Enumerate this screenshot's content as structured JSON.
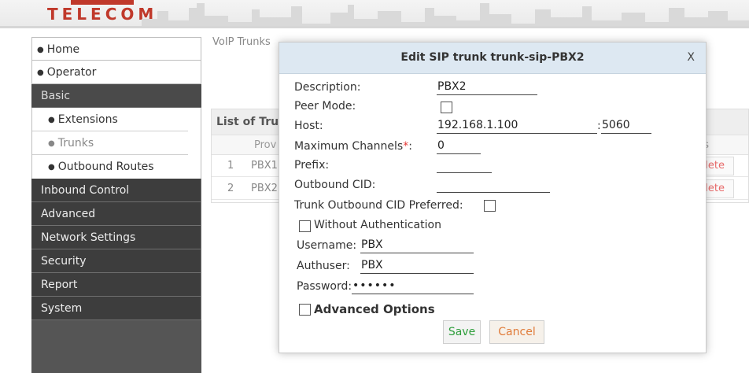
{
  "header": {
    "logo_text": "TELECOM"
  },
  "sidebar": {
    "top_items": [
      {
        "label": "Home"
      },
      {
        "label": "Operator"
      }
    ],
    "basic_label": "Basic",
    "basic_items": [
      {
        "label": "Extensions"
      },
      {
        "label": "Trunks"
      },
      {
        "label": "Outbound Routes"
      }
    ],
    "items": [
      {
        "label": "Inbound Control"
      },
      {
        "label": "Advanced"
      },
      {
        "label": "Network Settings"
      },
      {
        "label": "Security"
      },
      {
        "label": "Report"
      },
      {
        "label": "System"
      }
    ]
  },
  "main": {
    "title": "VoIP Trunks",
    "list_title": "List of Tru",
    "col_prov": "Prov",
    "col_s": "s",
    "rows": [
      {
        "num": "1",
        "prov": "PBX1",
        "action": "lete"
      },
      {
        "num": "2",
        "prov": "PBX2",
        "action": "lete"
      }
    ]
  },
  "modal": {
    "title": "Edit SIP trunk trunk-sip-PBX2",
    "close": "X",
    "description_label": "Description:",
    "description_value": "PBX2",
    "peer_mode_label": "Peer Mode:",
    "host_label": "Host:",
    "host_value": "192.168.1.100",
    "port_sep": ":",
    "port_value": "5060",
    "max_channels_label": "Maximum Channels",
    "required_mark": "*",
    "label_colon": ":",
    "max_channels_value": "0",
    "prefix_label": "Prefix:",
    "prefix_value": "",
    "outbound_cid_label": "Outbound CID:",
    "outbound_cid_value": "",
    "trunk_cid_preferred_label": "Trunk Outbound CID Preferred:",
    "without_auth_label": "Without Authentication",
    "username_label": "Username:",
    "username_value": "PBX",
    "authuser_label": "Authuser:",
    "authuser_value": "PBX",
    "password_label": "Password:",
    "password_value": "••••••",
    "advanced_options_label": "Advanced Options",
    "save_label": "Save",
    "cancel_label": "Cancel"
  }
}
